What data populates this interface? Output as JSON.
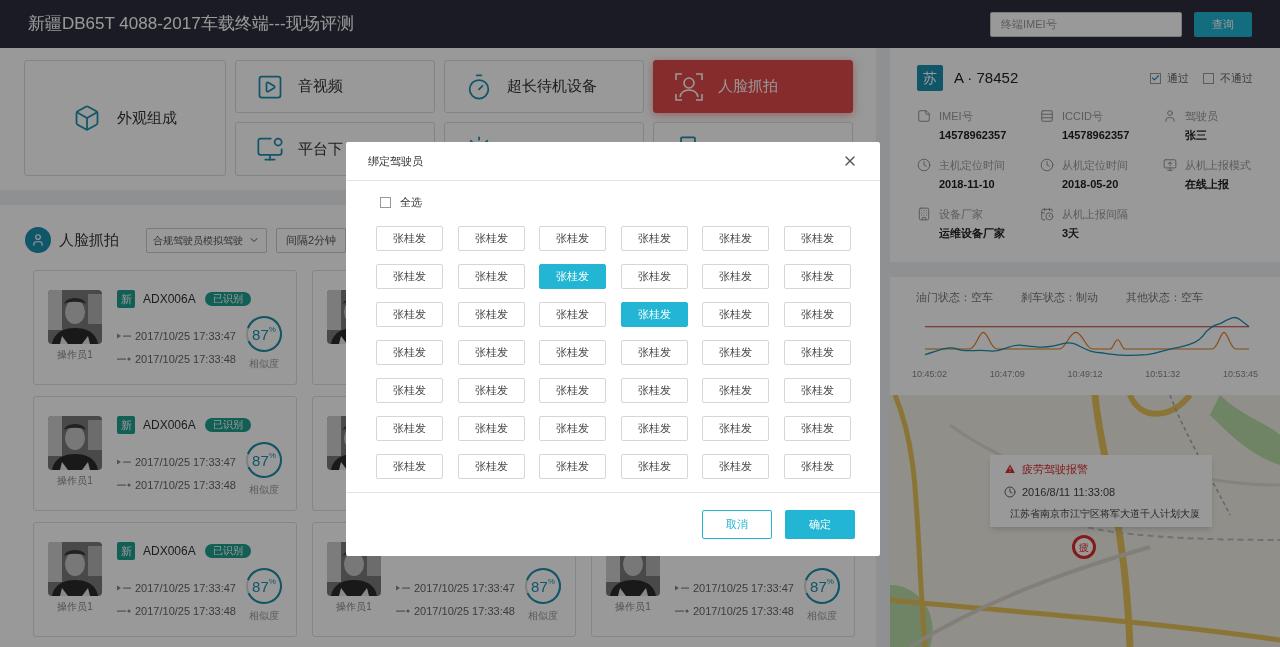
{
  "header": {
    "title": "新疆DB65T 4088-2017车载终端---现场评测",
    "search": {
      "placeholder": "终端IMEI号"
    },
    "search_button": "查询"
  },
  "modules": [
    {
      "label": "外观组成",
      "selected": false
    },
    {
      "label": "音视频",
      "selected": false
    },
    {
      "label": "超长待机设备",
      "selected": false
    },
    {
      "label": "人脸抓拍",
      "selected": true
    },
    {
      "label": "平台下",
      "selected": false
    },
    {
      "selected": false
    },
    {
      "selected": false
    }
  ],
  "capture": {
    "title": "人脸抓拍",
    "filter": "合规驾驶员模拟驾驶",
    "interval": "间隔2分钟",
    "rows": [
      [
        {
          "photo": {
            "kind": "picture"
          },
          "operator": "操作员1",
          "tag": "新",
          "plate": "ADX006A",
          "status": "已识别",
          "times": [
            "2017/10/25 17:33:47",
            "2017/10/25 17:33:48"
          ],
          "score": "87",
          "unit": "%",
          "level": 0.87,
          "score_label": "相似度"
        },
        {
          "photo": {
            "kind": "picture"
          }
        }
      ],
      [
        {
          "photo": {
            "kind": "picture"
          },
          "operator": "操作员1",
          "tag": "新",
          "plate": "ADX006A",
          "status": "已识别",
          "times": [
            "2017/10/25 17:33:47",
            "2017/10/25 17:33:48"
          ],
          "score": "87",
          "unit": "%",
          "level": 0.87,
          "score_label": "相似度"
        },
        {
          "photo": {
            "kind": "picture"
          }
        }
      ],
      [
        {
          "photo": {
            "kind": "picture"
          },
          "operator": "操作员1",
          "tag": "新",
          "plate": "ADX006A",
          "status": "已识别",
          "times": [
            "2017/10/25 17:33:47",
            "2017/10/25 17:33:48"
          ],
          "score": "87",
          "unit": "%",
          "level": 0.87,
          "score_label": "相似度"
        },
        {
          "photo": {
            "kind": "picture"
          },
          "operator": "操作员1",
          "times": [
            "2017/10/25 17:33:47",
            "2017/10/25 17:33:48"
          ],
          "score": "87",
          "unit": "%",
          "level": 0.87,
          "score_label": "相似度"
        },
        {
          "photo": {
            "kind": "picture"
          },
          "operator": "操作员1",
          "times": [
            "2017/10/25 17:33:47",
            "2017/10/25 17:33:48"
          ],
          "score": "87",
          "unit": "%",
          "level": 0.87,
          "score_label": "相似度"
        }
      ]
    ]
  },
  "vehicle": {
    "province": "苏",
    "plate": "A · 78452",
    "checks": [
      {
        "label": "通过",
        "checked": true
      },
      {
        "label": "不通过",
        "checked": false
      }
    ],
    "fields": [
      {
        "label": "IMEI号",
        "value": "14578962357"
      },
      {
        "label": "ICCID号",
        "value": "14578962357"
      },
      {
        "label": "驾驶员",
        "value": "张三"
      },
      {
        "label": "主机定位时间",
        "value": "2018-11-10"
      },
      {
        "label": "从机定位时间",
        "value": "2018-05-20"
      },
      {
        "label": "从机上报模式",
        "value": "在线上报"
      },
      {
        "label": "设备厂家",
        "value": "运维设备厂家"
      },
      {
        "label": "从机上报间隔",
        "value": "3天"
      }
    ]
  },
  "chart": {
    "states": [
      "油门状态：空车",
      "刹车状态：制动",
      "其他状态：空车"
    ],
    "time_labels": [
      "10:45:02",
      "10:47:09",
      "10:49:12",
      "10:51:32",
      "10:53:45"
    ]
  },
  "map": {
    "kind": "picture",
    "alert": {
      "title": "疲劳驾驶报警",
      "time": "2016/8/11 11:33:08",
      "address": "江苏省南京市江宁区将军大道千人计划大厦"
    },
    "marker": "疲"
  },
  "dialog": {
    "title": "绑定驾驶员",
    "select_all": {
      "label": "全选",
      "checked": false
    },
    "drivers": [
      {
        "label": "张桂发",
        "selected": false
      },
      {
        "label": "张桂发",
        "selected": false
      },
      {
        "label": "张桂发",
        "selected": false
      },
      {
        "label": "张桂发",
        "selected": false
      },
      {
        "label": "张桂发",
        "selected": false
      },
      {
        "label": "张桂发",
        "selected": false
      },
      {
        "label": "张桂发",
        "selected": false
      },
      {
        "label": "张桂发",
        "selected": false
      },
      {
        "label": "张桂发",
        "selected": true
      },
      {
        "label": "张桂发",
        "selected": false
      },
      {
        "label": "张桂发",
        "selected": false
      },
      {
        "label": "张桂发",
        "selected": false
      },
      {
        "label": "张桂发",
        "selected": false
      },
      {
        "label": "张桂发",
        "selected": false
      },
      {
        "label": "张桂发",
        "selected": false
      },
      {
        "label": "张桂发",
        "selected": true
      },
      {
        "label": "张桂发",
        "selected": false
      },
      {
        "label": "张桂发",
        "selected": false
      },
      {
        "label": "张桂发",
        "selected": false
      },
      {
        "label": "张桂发",
        "selected": false
      },
      {
        "label": "张桂发",
        "selected": false
      },
      {
        "label": "张桂发",
        "selected": false
      },
      {
        "label": "张桂发",
        "selected": false
      },
      {
        "label": "张桂发",
        "selected": false
      },
      {
        "label": "张桂发",
        "selected": false
      },
      {
        "label": "张桂发",
        "selected": false
      },
      {
        "label": "张桂发",
        "selected": false
      },
      {
        "label": "张桂发",
        "selected": false
      },
      {
        "label": "张桂发",
        "selected": false
      },
      {
        "label": "张桂发",
        "selected": false
      },
      {
        "label": "张桂发",
        "selected": false
      },
      {
        "label": "张桂发",
        "selected": false
      },
      {
        "label": "张桂发",
        "selected": false
      },
      {
        "label": "张桂发",
        "selected": false
      },
      {
        "label": "张桂发",
        "selected": false
      },
      {
        "label": "张桂发",
        "selected": false
      },
      {
        "label": "张桂发",
        "selected": false
      },
      {
        "label": "张桂发",
        "selected": false
      },
      {
        "label": "张桂发",
        "selected": false
      },
      {
        "label": "张桂发",
        "selected": false
      },
      {
        "label": "张桂发",
        "selected": false
      },
      {
        "label": "张桂发",
        "selected": false
      }
    ],
    "cancel": "取消",
    "confirm": "确定"
  }
}
